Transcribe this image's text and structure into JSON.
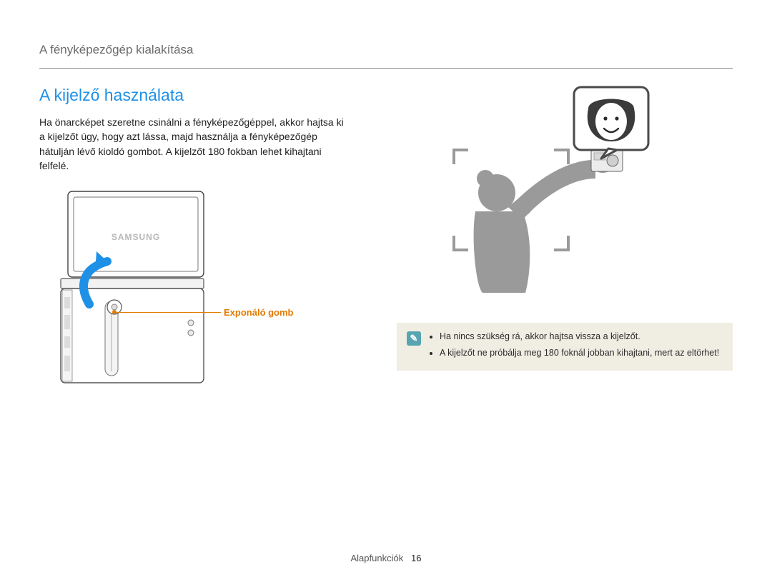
{
  "header": {
    "breadcrumb": "A fényképezőgép kialakítása"
  },
  "section": {
    "title": "A kijelző használata",
    "body": "Ha önarcképet szeretne csinálni a fényképezőgéppel, akkor hajtsa ki a kijelzőt úgy, hogy azt lássa, majd használja a fényképezőgép hátulján lévő kioldó gombot. A kijelzőt 180 fokban lehet kihajtani felfelé."
  },
  "callouts": {
    "shutter_label": "Exponáló gomb"
  },
  "figure": {
    "brand_text": "SAMSUNG"
  },
  "note": {
    "items": [
      "Ha nincs szükség rá, akkor hajtsa vissza a kijelzőt.",
      "A kijelzőt ne próbálja meg 180 foknál jobban kihajtani, mert az eltörhet!"
    ],
    "icon_glyph": "✎"
  },
  "footer": {
    "section_label": "Alapfunkciók",
    "page_number": "16"
  }
}
